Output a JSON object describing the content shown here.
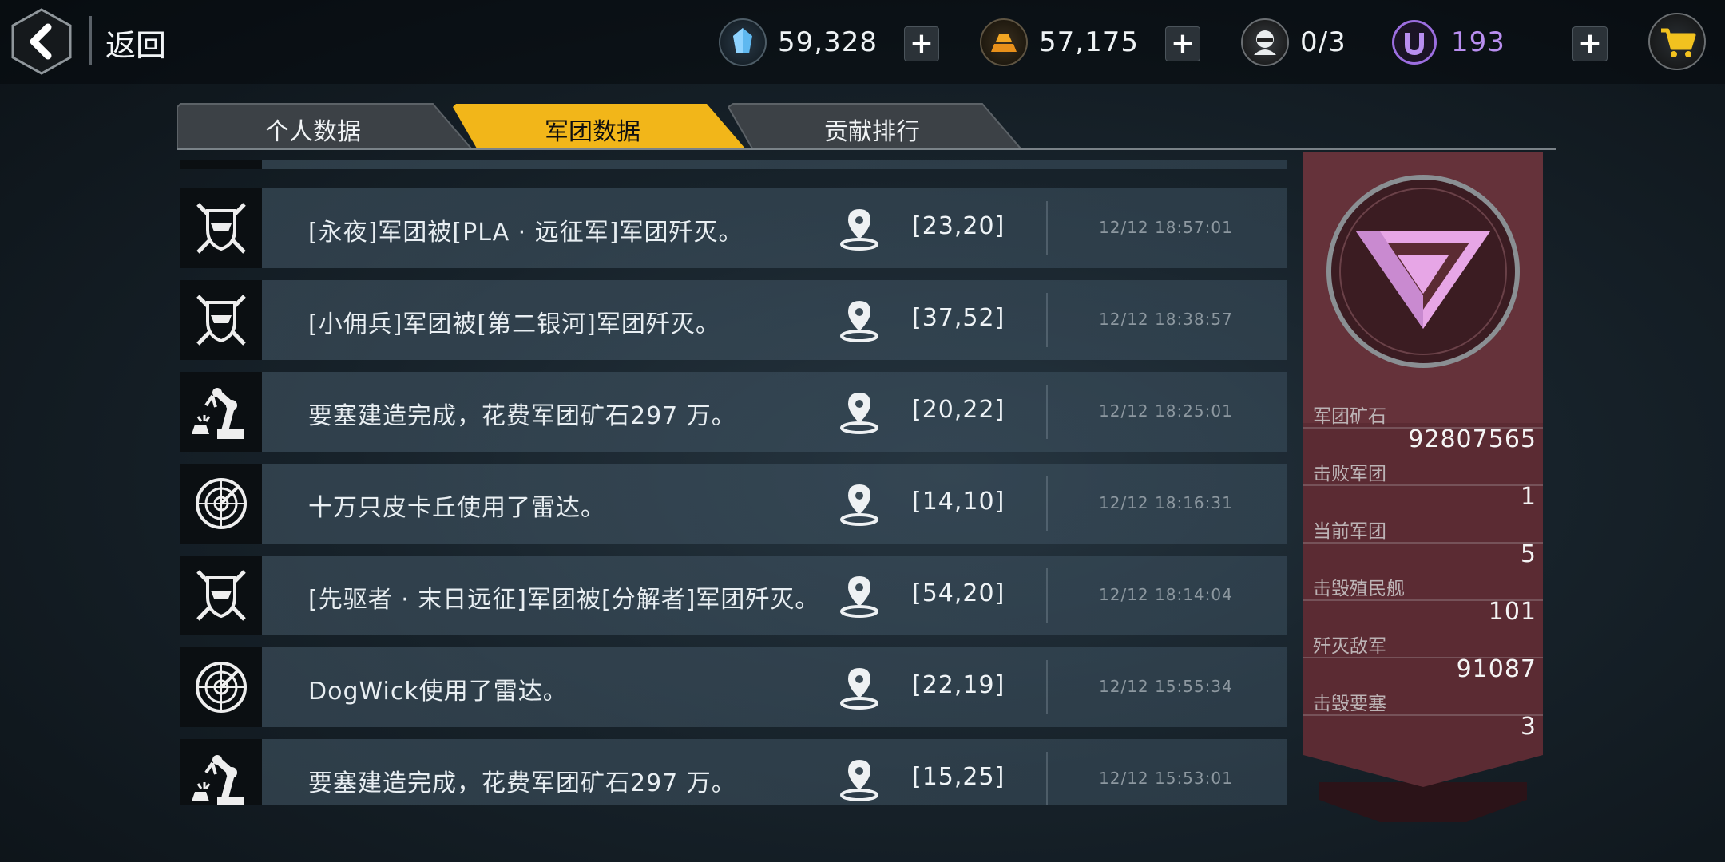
{
  "header": {
    "back_label": "返回",
    "resources": [
      {
        "name": "crystal-resource",
        "value": "59,328"
      },
      {
        "name": "gold-resource",
        "value": "57,175"
      },
      {
        "name": "pilot-resource",
        "value": "0/3"
      },
      {
        "name": "u-currency",
        "value": "193"
      }
    ]
  },
  "tabs": [
    {
      "label": "个人数据",
      "active": false
    },
    {
      "label": "军团数据",
      "active": true
    },
    {
      "label": "贡献排行",
      "active": false
    }
  ],
  "log": [
    {
      "icon": "crossed-swords-shield-icon",
      "text": "[永夜]军团被[PLA · 远征军]军团歼灭。",
      "coord": "[23,20]",
      "time": "12/12 18:57:01"
    },
    {
      "icon": "crossed-swords-shield-icon",
      "text": "[小佣兵]军团被[第二银河]军团歼灭。",
      "coord": "[37,52]",
      "time": "12/12 18:38:57"
    },
    {
      "icon": "robot-arm-icon",
      "text": "要塞建造完成，花费军团矿石297 万。",
      "coord": "[20,22]",
      "time": "12/12 18:25:01"
    },
    {
      "icon": "radar-icon",
      "text": "十万只皮卡丘使用了雷达。",
      "coord": "[14,10]",
      "time": "12/12 18:16:31"
    },
    {
      "icon": "crossed-swords-shield-icon",
      "text": "[先驱者 · 末日远征]军团被[分解者]军团歼灭。",
      "coord": "[54,20]",
      "time": "12/12 18:14:04"
    },
    {
      "icon": "radar-icon",
      "text": "DogWick使用了雷达。",
      "coord": "[22,19]",
      "time": "12/12 15:55:34"
    },
    {
      "icon": "robot-arm-icon",
      "text": "要塞建造完成，花费军团矿石297 万。",
      "coord": "[15,25]",
      "time": "12/12 15:53:01"
    }
  ],
  "legion_stats": [
    {
      "label": "军团矿石",
      "value": "92807565"
    },
    {
      "label": "击败军团",
      "value": "1"
    },
    {
      "label": "当前军团",
      "value": "5"
    },
    {
      "label": "击毁殖民舰",
      "value": "101"
    },
    {
      "label": "歼灭敌军",
      "value": "91087"
    },
    {
      "label": "击毁要塞",
      "value": "3"
    }
  ],
  "colors": {
    "accent": "#f2b619",
    "legion_emblem": "#e7a6e6",
    "panel": "#5b2b33",
    "u_currency": "#b98ef0"
  }
}
